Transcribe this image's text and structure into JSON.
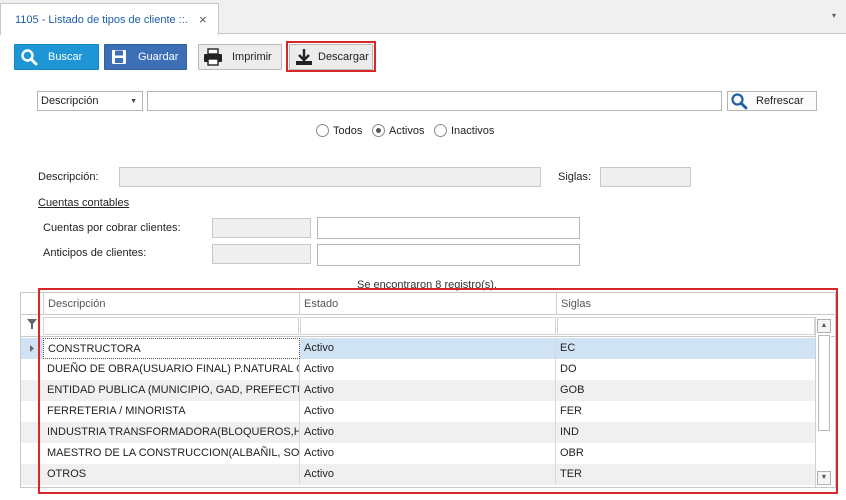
{
  "tab": {
    "title": "1105 - Listado de tipos de cliente ::.",
    "close": "×",
    "chevron": "▾"
  },
  "toolbar": {
    "search": "Buscar",
    "save": "Guardar",
    "print": "Imprimir",
    "download": "Descargar"
  },
  "filter": {
    "field_value": "Descripción",
    "search_value": "",
    "refresh": "Refrescar",
    "radio_all": "Todos",
    "radio_active": "Activos",
    "radio_inactive": "Inactivos",
    "selected": "Activos"
  },
  "form": {
    "description_label": "Descripción:",
    "siglas_label": "Siglas:",
    "accounts_title": "Cuentas contables",
    "receivable_label": "Cuentas por cobrar clientes:",
    "advances_label": "Anticipos de clientes:"
  },
  "results": {
    "count_text": "Se encontraron 8 registro(s)."
  },
  "grid": {
    "columns": [
      "Descripción",
      "Estado",
      "Siglas"
    ],
    "rows": [
      {
        "descripcion": "CONSTRUCTORA",
        "estado": "Activo",
        "siglas": "EC"
      },
      {
        "descripcion": "DUEÑO DE OBRA(USUARIO FINAL) P.NATURAL O...",
        "estado": "Activo",
        "siglas": "DO"
      },
      {
        "descripcion": "ENTIDAD PUBLICA (MUNICIPIO, GAD, PREFECTU...",
        "estado": "Activo",
        "siglas": "GOB"
      },
      {
        "descripcion": "FERRETERIA / MINORISTA",
        "estado": "Activo",
        "siglas": "FER"
      },
      {
        "descripcion": "INDUSTRIA TRANSFORMADORA(BLOQUEROS,HO...",
        "estado": "Activo",
        "siglas": "IND"
      },
      {
        "descripcion": "MAESTRO DE LA CONSTRUCCION(ALBAÑIL, SOL...",
        "estado": "Activo",
        "siglas": "OBR"
      },
      {
        "descripcion": "OTROS",
        "estado": "Activo",
        "siglas": "TER"
      }
    ]
  },
  "colors": {
    "accent": "#1e95d4",
    "navy": "#3c6fb6",
    "highlight": "#d9262b",
    "selection": "#cfe3f5"
  }
}
